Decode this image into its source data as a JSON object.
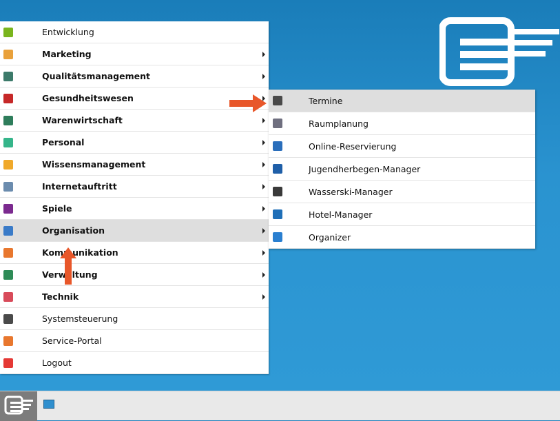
{
  "menu": {
    "items": [
      {
        "label": "Entwicklung",
        "bold": false,
        "submenu": false,
        "icon": "sparkle-icon",
        "color": "#7ab51d"
      },
      {
        "label": "Marketing",
        "bold": true,
        "submenu": true,
        "icon": "marketing-icon",
        "color": "#e9a13b"
      },
      {
        "label": "Qualitätsmanagement",
        "bold": true,
        "submenu": true,
        "icon": "star-icon",
        "color": "#3c7a6a"
      },
      {
        "label": "Gesundheitswesen",
        "bold": true,
        "submenu": true,
        "icon": "caduceus-icon",
        "color": "#c62828"
      },
      {
        "label": "Warenwirtschaft",
        "bold": true,
        "submenu": true,
        "icon": "money-icon",
        "color": "#2e7d5b"
      },
      {
        "label": "Personal",
        "bold": true,
        "submenu": true,
        "icon": "people-icon",
        "color": "#35b58a"
      },
      {
        "label": "Wissensmanagement",
        "bold": true,
        "submenu": true,
        "icon": "book-icon",
        "color": "#f0a92a"
      },
      {
        "label": "Internetauftritt",
        "bold": true,
        "submenu": true,
        "icon": "globe-icon",
        "color": "#6b8cae"
      },
      {
        "label": "Spiele",
        "bold": true,
        "submenu": true,
        "icon": "game-icon",
        "color": "#7b2a8f"
      },
      {
        "label": "Organisation",
        "bold": true,
        "submenu": true,
        "icon": "organisation-icon",
        "color": "#3a7bc8",
        "active": true
      },
      {
        "label": "Kommunikation",
        "bold": true,
        "submenu": true,
        "icon": "chat-icon",
        "color": "#e8772e"
      },
      {
        "label": "Verwaltung",
        "bold": true,
        "submenu": true,
        "icon": "ledger-icon",
        "color": "#2e8b57"
      },
      {
        "label": "Technik",
        "bold": true,
        "submenu": true,
        "icon": "gears-icon",
        "color": "#d84b5a"
      },
      {
        "label": "Systemsteuerung",
        "bold": false,
        "submenu": false,
        "icon": "sliders-icon",
        "color": "#4a4a4a"
      },
      {
        "label": "Service-Portal",
        "bold": false,
        "submenu": false,
        "icon": "service-icon",
        "color": "#e8772e"
      },
      {
        "label": "Logout",
        "bold": false,
        "submenu": false,
        "icon": "power-icon",
        "color": "#e53935"
      }
    ]
  },
  "submenu": {
    "items": [
      {
        "label": "Termine",
        "icon": "termine-icon",
        "color": "#4a4a4a",
        "active": true
      },
      {
        "label": "Raumplanung",
        "icon": "room-icon",
        "color": "#6f6f7f"
      },
      {
        "label": "Online-Reservierung",
        "icon": "reservation-icon",
        "color": "#2a6ebb"
      },
      {
        "label": "Jugendherbegen-Manager",
        "icon": "bed-icon",
        "color": "#1f5fa8"
      },
      {
        "label": "Wasserski-Manager",
        "icon": "waterski-icon",
        "color": "#3a3a3a"
      },
      {
        "label": "Hotel-Manager",
        "icon": "hotel-icon",
        "color": "#1f6fb8"
      },
      {
        "label": "Organizer",
        "icon": "organizer-icon",
        "color": "#2a7fd0"
      }
    ]
  },
  "colors": {
    "accent": "#e8572a",
    "desktop": "#2a93d0"
  }
}
